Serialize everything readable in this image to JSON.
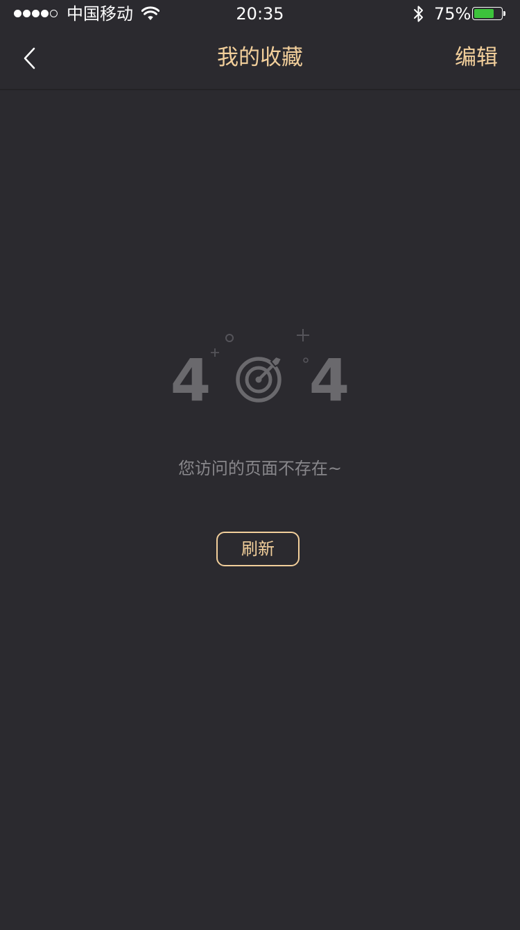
{
  "status_bar": {
    "carrier": "中国移动",
    "time": "20:35",
    "battery_percent": "75%",
    "battery_level": 0.75,
    "signal_bars_filled": 4,
    "signal_bars_total": 5,
    "icons": [
      "wifi-icon",
      "bluetooth-icon",
      "battery-icon"
    ]
  },
  "nav": {
    "title": "我的收藏",
    "edit_label": "编辑",
    "back_icon": "chevron-left-icon"
  },
  "empty_state": {
    "code_left": "4",
    "code_right": "4",
    "center_icon": "target-arrow-icon",
    "message": "您访问的页面不存在~",
    "refresh_label": "刷新"
  },
  "colors": {
    "background": "#2b2a2f",
    "accent": "#f2cf9b",
    "muted_text": "#88878b",
    "illustration": "#6a696d",
    "battery_fill": "#3cc33b"
  }
}
